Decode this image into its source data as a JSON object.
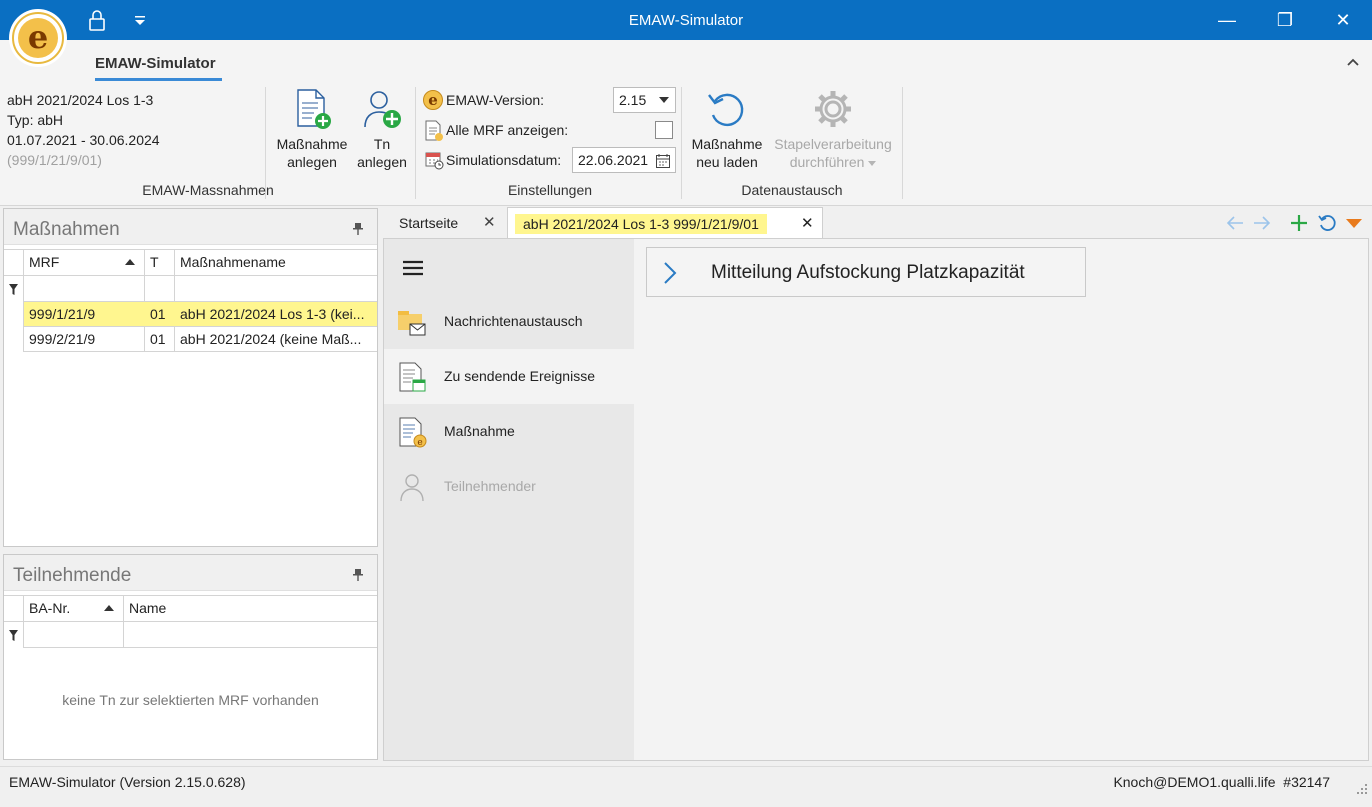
{
  "window": {
    "title": "EMAW-Simulator",
    "minimize": "—",
    "restore": "❐",
    "close": "✕"
  },
  "ribbon": {
    "tab_label": "EMAW-Simulator",
    "collapse": "^",
    "info": {
      "line1": "abH 2021/2024 Los 1-3",
      "line2": "Typ: abH",
      "line3": "01.07.2021 - 30.06.2024",
      "line4": "(999/1/21/9/01)"
    },
    "groups": {
      "massnahmen": {
        "label": "EMAW-Massnahmen",
        "btn_massnahme_l1": "Maßnahme",
        "btn_massnahme_l2": "anlegen",
        "btn_tn_l1": "Tn",
        "btn_tn_l2": "anlegen"
      },
      "einstellungen": {
        "label": "Einstellungen",
        "version_label": "EMAW-Version:",
        "version_value": "2.15",
        "alle_mrf_label": "Alle MRF anzeigen:",
        "alle_mrf_checked": false,
        "simdatum_label": "Simulationsdatum:",
        "simdatum_value": "22.06.2021"
      },
      "datenaustausch": {
        "label": "Datenaustausch",
        "reload_l1": "Maßnahme",
        "reload_l2": "neu laden",
        "batch_l1": "Stapelverarbeitung",
        "batch_l2": "durchführen"
      }
    }
  },
  "massnahmen_panel": {
    "title": "Maßnahmen",
    "columns": [
      "MRF",
      "T",
      "Maßnahmename"
    ],
    "rows": [
      {
        "mrf": "999/1/21/9",
        "t": "01",
        "name": "abH 2021/2024 Los 1-3 (kei...",
        "selected": true
      },
      {
        "mrf": "999/2/21/9",
        "t": "01",
        "name": "abH 2021/2024 (keine Maß...",
        "selected": false
      }
    ]
  },
  "teilnehmende_panel": {
    "title": "Teilnehmende",
    "columns": [
      "BA-Nr.",
      "Name"
    ],
    "empty_text": "keine Tn zur selektierten MRF vorhanden"
  },
  "tabs": [
    {
      "label": "Startseite",
      "active": false
    },
    {
      "label": "abH 2021/2024 Los 1-3 999/1/21/9/01",
      "active": true
    }
  ],
  "nav": {
    "items": [
      {
        "label": "Nachrichtenaustausch",
        "icon": "mail-folder-icon",
        "enabled": true
      },
      {
        "label": "Zu sendende Ereignisse",
        "icon": "events-doc-icon",
        "enabled": true
      },
      {
        "label": "Maßnahme",
        "icon": "massnahme-doc-icon",
        "enabled": true
      },
      {
        "label": "Teilnehmender",
        "icon": "person-icon",
        "enabled": false
      }
    ]
  },
  "main": {
    "expander_label": "Mitteilung Aufstockung Platzkapazität"
  },
  "statusbar": {
    "left": "EMAW-Simulator (Version 2.15.0.628)",
    "right": "Knoch@DEMO1.qualli.life  #32147"
  },
  "colors": {
    "titlebar": "#0a6fc2",
    "selection": "#fff68f",
    "accent_orange": "#e87a1c",
    "accent_green": "#2aa845",
    "accent_blue": "#2a8ad6"
  }
}
